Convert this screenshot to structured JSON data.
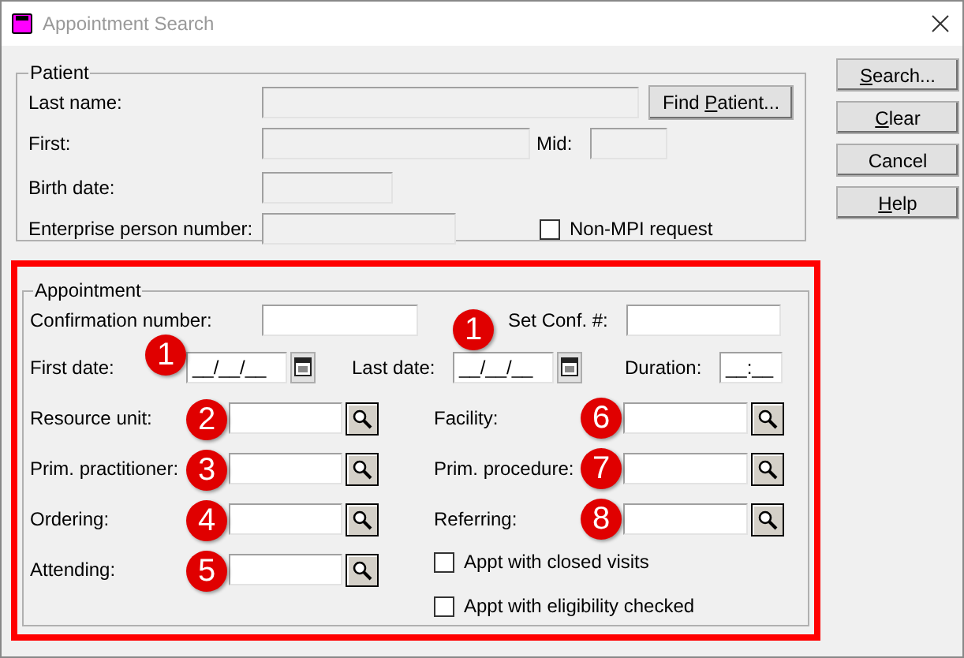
{
  "window": {
    "title": "Appointment Search"
  },
  "patient": {
    "legend": "Patient",
    "last_name": {
      "label": "Last name:",
      "disabled": true
    },
    "find_button": {
      "pre": "Find ",
      "key": "P",
      "post": "atient..."
    },
    "first": {
      "label": "First:",
      "disabled": true
    },
    "mid": {
      "label": "Mid:",
      "disabled": true
    },
    "birth_date": {
      "label": "Birth date:",
      "disabled": true
    },
    "enterprise": {
      "label": "Enterprise person number:",
      "disabled": true
    },
    "non_mpi": {
      "label": "Non-MPI request",
      "checked": false
    }
  },
  "buttons": [
    {
      "key": "S",
      "post": "earch..."
    },
    {
      "key": "C",
      "post": "lear"
    },
    {
      "pre": "Cancel"
    },
    {
      "key": "H",
      "post": "elp"
    }
  ],
  "appointment": {
    "legend": "Appointment",
    "confirmation": {
      "label": "Confirmation number:"
    },
    "set_conf": {
      "label": "Set Conf. #:"
    },
    "first_date": {
      "label": "First date:",
      "value": "__/__/__",
      "badge": "1"
    },
    "last_date": {
      "label": "Last date:",
      "value": "__/__/__",
      "badge": "1"
    },
    "duration": {
      "label": "Duration:",
      "value": "__:__"
    },
    "lookups_left": [
      {
        "label": "Resource unit:",
        "badge": "2"
      },
      {
        "label": "Prim. practitioner:",
        "badge": "3"
      },
      {
        "label": "Ordering:",
        "badge": "4"
      },
      {
        "label": "Attending:",
        "badge": "5"
      }
    ],
    "lookups_right": [
      {
        "label": "Facility:",
        "badge": "6"
      },
      {
        "label": "Prim. procedure:",
        "badge": "7"
      },
      {
        "label": "Referring:",
        "badge": "8"
      }
    ],
    "checkboxes": [
      {
        "label": "Appt with closed visits",
        "checked": false
      },
      {
        "label": "Appt with eligibility checked",
        "checked": false
      }
    ]
  }
}
